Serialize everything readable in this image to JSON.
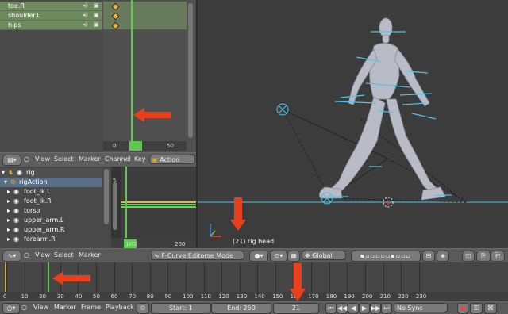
{
  "top_channels": [
    "toe.R",
    "shoulder.L",
    "hips"
  ],
  "dopesheet_header": {
    "menus": [
      "View",
      "Select",
      "Marker",
      "Channel",
      "Key"
    ],
    "mode": "Action Editor"
  },
  "top_ruler": [
    "0",
    "50"
  ],
  "rig_tree": {
    "object": "rig",
    "action": "rigAction",
    "bones": [
      "foot_ik.L",
      "foot_ik.R",
      "torso",
      "upper_arm.L",
      "upper_arm.R",
      "forearm.R"
    ]
  },
  "graph_ruler": [
    "100",
    "200"
  ],
  "graph_side_ticks": [
    "5",
    "0",
    "5"
  ],
  "viewport": {
    "info": "(21) rig head"
  },
  "graph_header": {
    "menus": [
      "View",
      "Select",
      "Marker"
    ],
    "mode": "F-Curve Editor",
    "mode_suffix": "se Mode",
    "orientation": "Global"
  },
  "timeline_ticks": [
    "0",
    "10",
    "20",
    "30",
    "40",
    "50",
    "60",
    "70",
    "80",
    "90",
    "100",
    "110",
    "120",
    "130",
    "140",
    "150",
    "160",
    "170",
    "180",
    "190",
    "200",
    "210",
    "220",
    "230"
  ],
  "timeline_header": {
    "menus": [
      "View",
      "Marker",
      "Frame",
      "Playback"
    ],
    "start": "Start: 1",
    "end": "End: 250",
    "current": "21",
    "sync": "No Sync"
  },
  "colors": {
    "playhead": "#5ec850",
    "arrow": "#e8401c",
    "channel_row": "#6f8a5e",
    "armature": "#4fc4e8"
  }
}
